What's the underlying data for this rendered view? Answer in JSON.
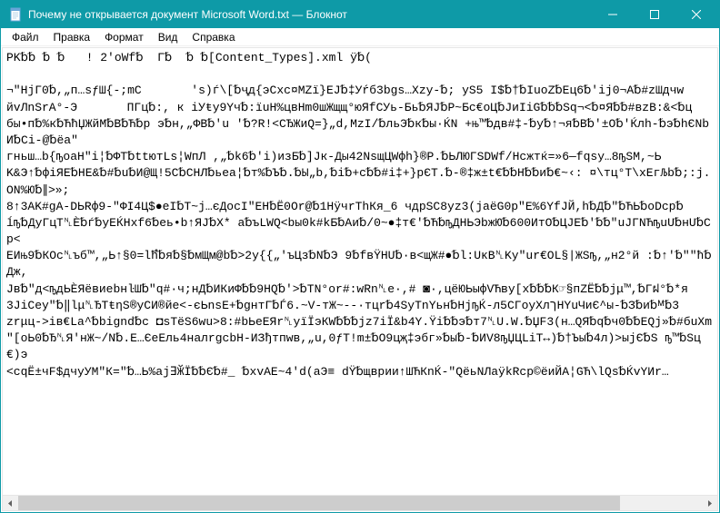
{
  "window": {
    "title": "Почему не открывается документ Microsoft Word.txt — Блокнот"
  },
  "menu": {
    "file": "Файл",
    "edit": "Правка",
    "format": "Формат",
    "view": "Вид",
    "help": "Справка"
  },
  "content": {
    "text": "PK␢␢ ␢ ␢   ! 2'oWf␢  Г␢  ␢ ␢[Content_Types].xml ÿ␢(\n\n¬\"HjГ0␢,„п…sƒШ{-;mC       's)ѓ\\[␢ҷд{эCxc¤MZï}EJ␢‡Уŕб3bgs…Xzy-␢; yS5 I$␢†␢IuoZ␢Ец6␢'ij0¬A␢#zШдчw\nйvЛnSrА°-Э       ПГц␢:, к iУŧy9Yч␢:ïuH%цвНm0шЖщщ°юЯfCУь-Бь␢ЯJ␢P~Бc€оЦ␢ЈиIiG␢␢␢Sq¬<␢¤Я␢␢#вzВ:&<␢ц\nбы•п␢%к␢ЋћЏЖйM␢В␢Ћ␢р э␢н,„ФВ␢'u '␢?R!<CЂЖиQ=}„d,MzI/␢льЭ␢к␢ы·ЌN +њ™␢дв#‡-␢у␢↑¬я␢В␢'±О␢'Ќлh-␢э␢hЄNbИ␢Ci-@␢ёа\"\nгньш…b{ҧoaН\"i¦␢ФТ␢ttютLs¦WпЛ ,„␢k6␢'i)изБ␢]Jк-Ды42NsщЦWфh}®P.␢ЬЛЮГSDWf/Нсжтќ=»6—fqsy…8ҧSM,~Ь\nK&Э↑␢фіЯЕ␢НЕ&␢#␢u␢И@Щ!5C␢CНЛ␢ьеа¦␢т%␢Ъ␢.␢Ы„b,␢i␢+c␢␢#i‡+}pЄT.␢-®‡ж±t€␢␢H␢␢и␢€~‹: ¤\\тц°T\\xЕгЉb␢;:j.ON%Ю␢∥>»;\n8↑3AK#gA-DЬRф9-\"ФI4Ц$●eI␢T~j…єДоcI\"EН␢Ё0Or@␢1НÿчrТhКя_6 чдрSC8yz3(jaёG0p\"E%6YfЈЙ,h␢Д␢\"␢ЋЬ␢оDcp␢\nĺҧ␢ДуГцТ␤Ѐ␢ѓ␢yEЌHxf6␢еь•b↑ЯJ␢X* a␢ъLWQ<bы0k#kБ␢Аи␢/0~●‡т€'␢Ћ␢ҧДНЬЭbжЮ␢600ИтО␢ЦЈЕ␢'␢␢\"uЈГNЋҧuU␢нU␢Cp<\nEИњ9␢КОс␤ъб™,„Ь↑§0=lћํ␢я␢§␢мЩм@b␢>2y{{„'ъЦз␢N␢Э 9␢fвŸНU␢·в<щЖ#●␢l:UκВ␤Ky\"ur€ОL§|ЖSҧ,„н2°й :␢↑'␢\"\"ћ␢Дж,\nJв␢″д<ҧдЬЀЯёвиebнŀШ␢″q#·ч;нД␢ИКиФ␢␢9HQ␢'>␢ТN°or#:wRn␤е·,# ◙·,цёЮЬыфVЋву[x␢␢␢К☞§пZЁ␢␢jμ™,␢Гฝ°␢*я\n3JiCey\"␢‖lμ␤ЂТŧηS®уCИ®йe<-єЬnsE+␢gнтГ␢Ѓ6.~V-тЖ~--·тцr␢4SyTnYьн␢HjҧЌ-л5CГоуXлךНYuЧиЄ^ы-␢З␢и␢ᴹ␢3\nzrμц->iв€La^␢bignd␢c ◘sTёS6wu>8:#bЬеEЯr␤уïÏэКW␢␢␢jz7iÏ&b4Y.Ÿi␢␢э␢т7␤U.W.␢ЏF3(н…QЯ␢q␢ч0␢␢EQj»␢#бuΧm\n\"[оЬ0␢Ђ␤Я'нЖ~/N␢.Е…ЄеЕль4налrgcbН-ИЗђтпwв,„u,0ƒТ!m±␢О9цҗ‡эбг»␢ы␢-␢ИV8ҧЏЦLіТ↔)␢†Ъы␢4л)>ыјЄ␢S ҧ™␢Sц€)э\n<сqЁ±чF$дчуУM\"К=\"␢…Ь%ај∃ӁÏ␢␢Є␢#_ ␢xvAE~4'd(аЭ≡ dŸ␢щврии↑ШЋКnЌ-\"QёьNЛаÿkRcp©ёиЙА¦GЋ\\lQs␢ЌvYИr…"
  }
}
